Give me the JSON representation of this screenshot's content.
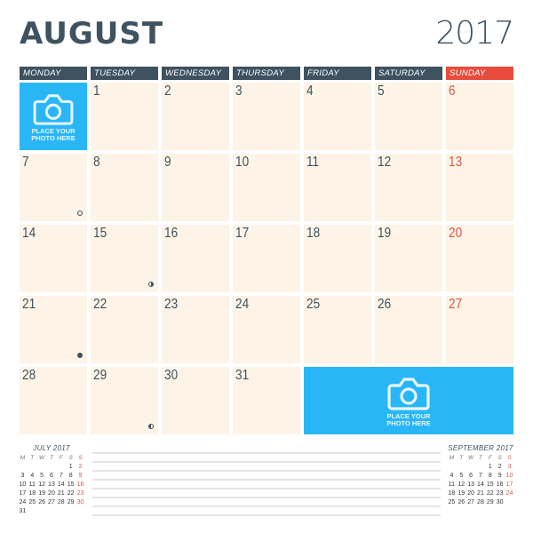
{
  "header": {
    "month": "AUGUST",
    "year": "2017"
  },
  "weekdays": [
    "MONDAY",
    "TUESDAY",
    "WEDNESDAY",
    "THURSDAY",
    "FRIDAY",
    "SATURDAY",
    "SUNDAY"
  ],
  "colors": {
    "header": "#3e5260",
    "sunday": "#e74c3c",
    "cell": "#fdf3e7",
    "photo": "#29b6f6"
  },
  "weeks": [
    [
      "",
      "1",
      "2",
      "3",
      "4",
      "5",
      "6"
    ],
    [
      "7",
      "8",
      "9",
      "10",
      "11",
      "12",
      "13"
    ],
    [
      "14",
      "15",
      "16",
      "17",
      "18",
      "19",
      "20"
    ],
    [
      "21",
      "22",
      "23",
      "24",
      "25",
      "26",
      "27"
    ],
    [
      "28",
      "29",
      "30",
      "31",
      "",
      "",
      ""
    ]
  ],
  "moon_phases": [
    {
      "day": "7",
      "phase": "full"
    },
    {
      "day": "15",
      "phase": "last-quarter"
    },
    {
      "day": "21",
      "phase": "new"
    },
    {
      "day": "29",
      "phase": "first-quarter"
    }
  ],
  "photo_placeholder": {
    "line1": "PLACE YOUR",
    "line2": "PHOTO HERE",
    "icon": "camera-icon"
  },
  "mini_calendars": {
    "prev": {
      "title": "JULY 2017",
      "weekdays": [
        "M",
        "T",
        "W",
        "T",
        "F",
        "S",
        "S"
      ],
      "weeks": [
        [
          "",
          "",
          "",
          "",
          "",
          "1",
          "2"
        ],
        [
          "3",
          "4",
          "5",
          "6",
          "7",
          "8",
          "9"
        ],
        [
          "10",
          "11",
          "12",
          "13",
          "14",
          "15",
          "16"
        ],
        [
          "17",
          "18",
          "19",
          "20",
          "21",
          "22",
          "23"
        ],
        [
          "24",
          "25",
          "26",
          "27",
          "28",
          "29",
          "30"
        ],
        [
          "31",
          "",
          "",
          "",
          "",
          "",
          ""
        ]
      ]
    },
    "next": {
      "title": "SEPTEMBER 2017",
      "weekdays": [
        "M",
        "T",
        "W",
        "T",
        "F",
        "S",
        "S"
      ],
      "weeks": [
        [
          "",
          "",
          "",
          "",
          "1",
          "2",
          "3"
        ],
        [
          "4",
          "5",
          "6",
          "7",
          "8",
          "9",
          "10"
        ],
        [
          "11",
          "12",
          "13",
          "14",
          "15",
          "16",
          "17"
        ],
        [
          "18",
          "19",
          "20",
          "21",
          "22",
          "23",
          "24"
        ],
        [
          "25",
          "26",
          "27",
          "28",
          "29",
          "30",
          ""
        ]
      ]
    }
  },
  "notes": {
    "line_count": 8
  }
}
